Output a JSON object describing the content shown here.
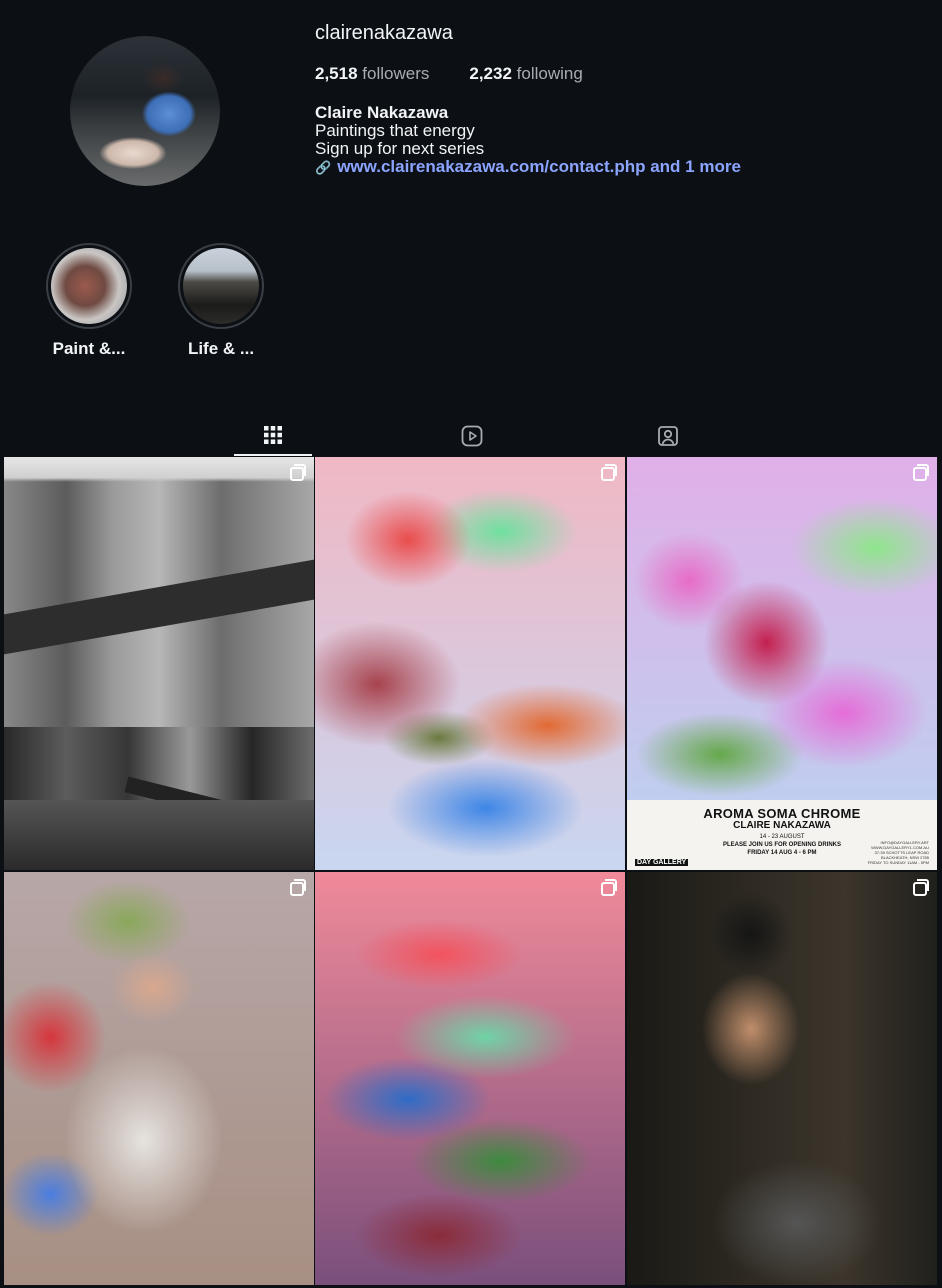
{
  "profile": {
    "username": "clairenakazawa",
    "followers_count": "2,518",
    "followers_label": "followers",
    "following_count": "2,232",
    "following_label": "following",
    "name": "Claire Nakazawa",
    "bio_lines": [
      "Paintings that energy",
      "Sign up for next series"
    ],
    "link_text": "www.clairenakazawa.com/contact.php and 1 more"
  },
  "highlights": [
    {
      "label": "Paint &..."
    },
    {
      "label": "Life & ..."
    }
  ],
  "tabs": [
    {
      "icon": "grid-icon",
      "active": true
    },
    {
      "icon": "reels-icon",
      "active": false
    },
    {
      "icon": "tagged-icon",
      "active": false
    }
  ],
  "posts": [
    {
      "type": "photo",
      "multi": true
    },
    {
      "type": "painting",
      "multi": true
    },
    {
      "type": "poster",
      "multi": true,
      "poster": {
        "title": "AROMA SOMA CHROME",
        "artist": "CLAIRE NAKAZAWA",
        "dates": "14 - 23 AUGUST",
        "invite": "PLEASE JOIN US FOR OPENING DRINKS",
        "opening": "FRIDAY 14 AUG 4 - 6 PM",
        "gallery_day": "DAY",
        "gallery_word": "GALLERY",
        "contact": [
          "INFO@DAYGALLERY.ART",
          "WWW.DAYGALLERY1.COM.AU",
          "37-39 SCHOTTS LEAP ROAD",
          "BLACKHEATH, NSW 2785",
          "FRIDAY TO SUNDAY 11AM - 5PM"
        ]
      }
    },
    {
      "type": "photo",
      "multi": true
    },
    {
      "type": "painting",
      "multi": true
    },
    {
      "type": "photo",
      "multi": true
    }
  ],
  "colors": {
    "background": "#0c1015",
    "link": "#8ba4ff",
    "muted": "#a8acb3"
  }
}
